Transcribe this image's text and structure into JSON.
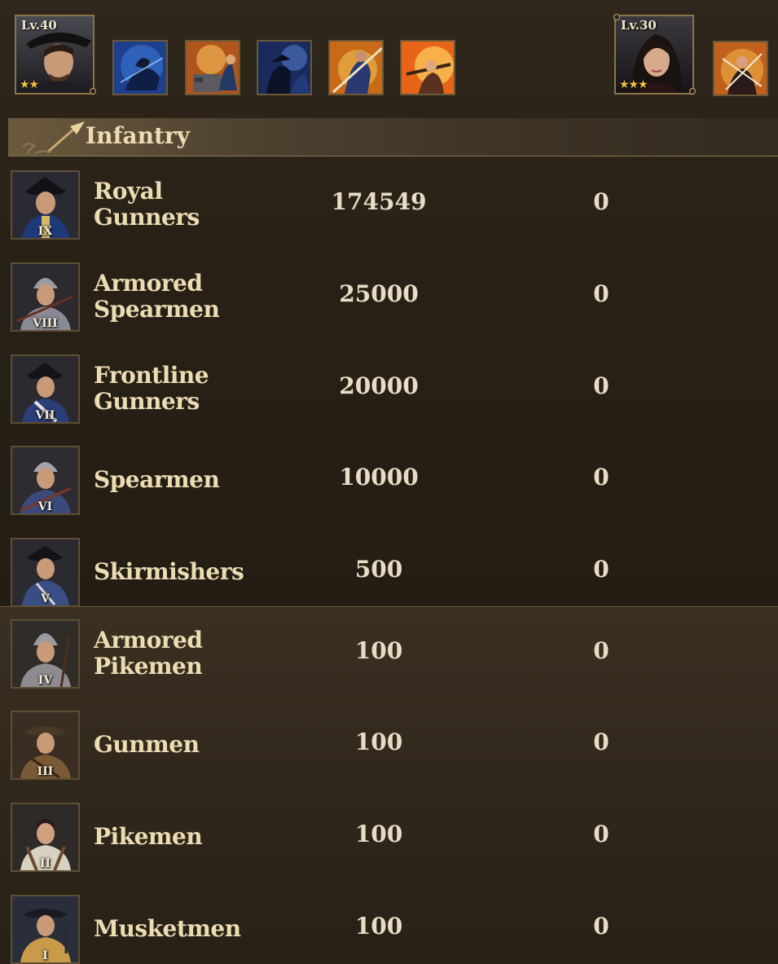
{
  "heroes": {
    "primary": {
      "level_label": "Lv.40",
      "stars": "★★"
    },
    "secondary": {
      "level_label": "Lv.30",
      "stars": "★★★"
    }
  },
  "skills": [
    "cavalry-charge-skill-icon",
    "cannon-fortify-skill-icon",
    "night-raid-skill-icon",
    "lance-strike-skill-icon",
    "musket-volley-skill-icon",
    "dual-blade-skill-icon"
  ],
  "category": {
    "title": "Infantry"
  },
  "troops": [
    {
      "name": "Royal\nGunners",
      "tier": "IX",
      "count": "174549",
      "second": "0"
    },
    {
      "name": "Armored\nSpearmen",
      "tier": "VIII",
      "count": "25000",
      "second": "0"
    },
    {
      "name": "Frontline\nGunners",
      "tier": "VII",
      "count": "20000",
      "second": "0"
    },
    {
      "name": "Spearmen",
      "tier": "VI",
      "count": "10000",
      "second": "0"
    },
    {
      "name": "Skirmishers",
      "tier": "V",
      "count": "500",
      "second": "0"
    },
    {
      "name": "Armored\nPikemen",
      "tier": "IV",
      "count": "100",
      "second": "0"
    },
    {
      "name": "Gunmen",
      "tier": "III",
      "count": "100",
      "second": "0"
    },
    {
      "name": "Pikemen",
      "tier": "II",
      "count": "100",
      "second": "0"
    },
    {
      "name": "Musketmen",
      "tier": "I",
      "count": "100",
      "second": "0"
    }
  ],
  "colors": {
    "gold_star": "#f3c440",
    "text": "#ecdcb4",
    "panel": "#2c2418",
    "header_band": "#6b5a3e"
  }
}
